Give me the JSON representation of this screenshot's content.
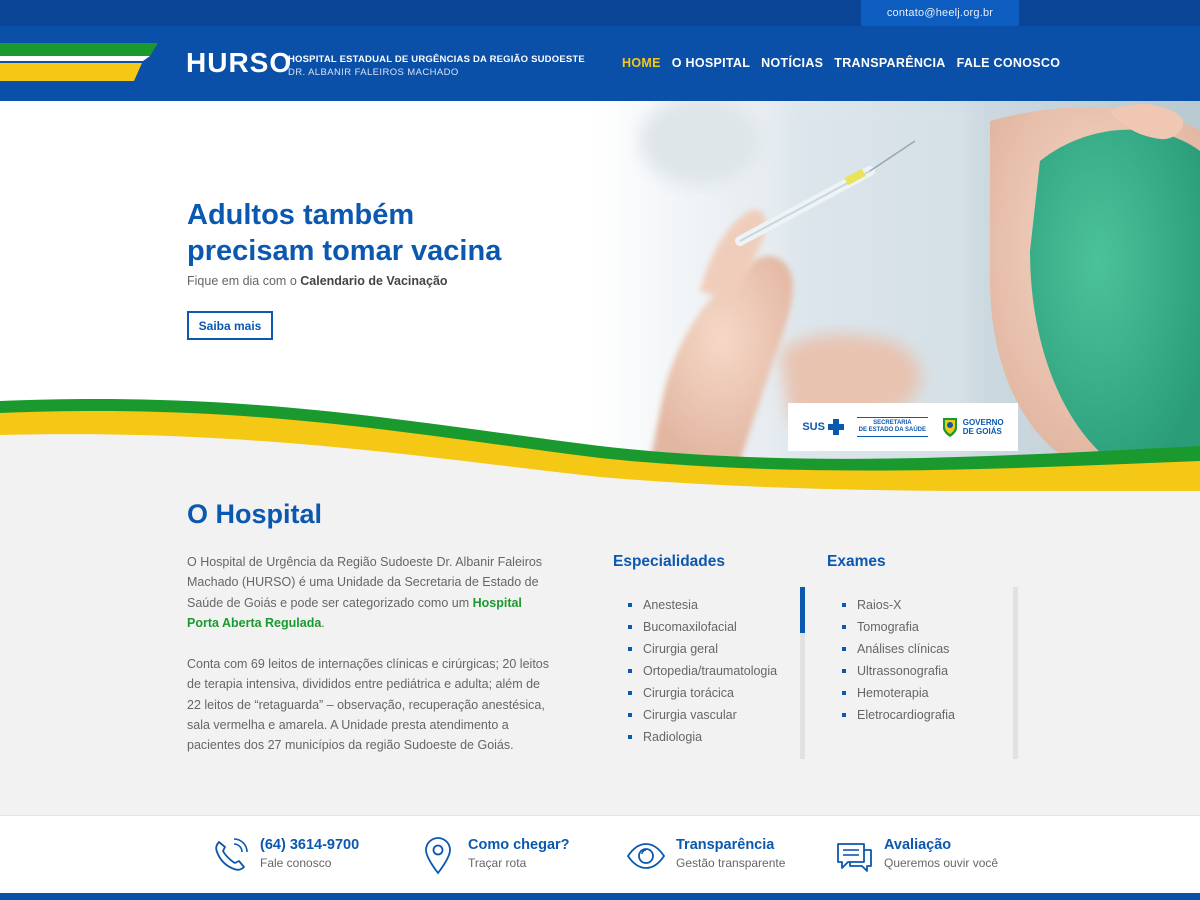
{
  "colors": {
    "brand_blue": "#0a4fa8",
    "accent_yellow": "#f4c814",
    "accent_green": "#1a9a2e"
  },
  "topbar": {
    "email": "contato@heelj.org.br"
  },
  "logo": {
    "name": "HURSO",
    "line1": "HOSPITAL ESTADUAL DE URGÊNCIAS DA REGIÃO SUDOESTE",
    "line2": "DR. ALBANIR FALEIROS MACHADO"
  },
  "nav": [
    "HOME",
    "O HOSPITAL",
    "NOTÍCIAS",
    "TRANSPARÊNCIA",
    "FALE CONOSCO"
  ],
  "hero": {
    "title_line1": "Adultos também",
    "title_line2": "precisam tomar vacina",
    "subtitle_prefix": "Fique em dia com o ",
    "subtitle_bold": "Calendario de Vacinação",
    "button": "Saiba mais",
    "logos": {
      "sus": "SUS",
      "secretaria_1": "SECRETARIA",
      "secretaria_2": "DE ESTADO DA SAÚDE",
      "governo_1": "GOVERNO",
      "governo_2": "DE GOIÁS"
    }
  },
  "about": {
    "title": "O Hospital",
    "p1_a": "O Hospital de Urgência da Região Sudoeste Dr. Albanir Faleiros Machado (HURSO) é uma Unidade da Secretaria de Estado de Saúde de Goiás e pode ser categorizado como um ",
    "p1_bold": "Hospital Porta Aberta Regulada",
    "p1_b": ".",
    "p2": "Conta com 69 leitos de internações clínicas e cirúrgicas; 20 leitos de terapia intensiva, divididos entre pediátrica e adulta; além de 22 leitos de “retaguarda” – observação, recuperação anestésica, sala vermelha e amarela. A Unidade presta atendimento a pacientes dos 27 municípios da região Sudoeste de Goiás."
  },
  "especialidades": {
    "title": "Especialidades",
    "items": [
      "Anestesia",
      "Bucomaxilofacial",
      "Cirurgia geral",
      "Ortopedia/traumatologia",
      "Cirurgia torácica",
      "Cirurgia vascular",
      "Radiologia"
    ]
  },
  "exames": {
    "title": "Exames",
    "items": [
      "Raios-X",
      "Tomografia",
      "Análises clínicas",
      "Ultrassonografia",
      "Hemoterapia",
      "Eletrocardiografia"
    ]
  },
  "footer": [
    {
      "icon": "phone-icon",
      "title": "(64) 3614-9700",
      "sub": "Fale conosco"
    },
    {
      "icon": "map-pin-icon",
      "title": "Como chegar?",
      "sub": "Traçar rota"
    },
    {
      "icon": "eye-icon",
      "title": "Transparência",
      "sub": "Gestão transparente"
    },
    {
      "icon": "chat-icon",
      "title": "Avaliação",
      "sub": "Queremos ouvir você"
    }
  ]
}
